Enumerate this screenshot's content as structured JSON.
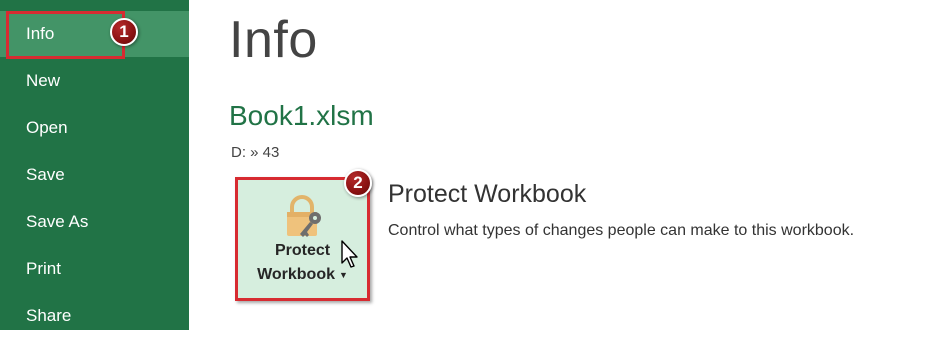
{
  "sidebar": {
    "items": [
      {
        "label": "Info"
      },
      {
        "label": "New"
      },
      {
        "label": "Open"
      },
      {
        "label": "Save"
      },
      {
        "label": "Save As"
      },
      {
        "label": "Print"
      },
      {
        "label": "Share"
      }
    ],
    "selected": "Info"
  },
  "main": {
    "title": "Info",
    "file_name": "Book1.xlsm",
    "file_path": "D: » 43",
    "protect": {
      "button_line1": "Protect",
      "button_line2": "Workbook",
      "heading": "Protect Workbook",
      "description": "Control what types of changes people can make to this workbook.",
      "icon": "lock-key-icon"
    }
  },
  "annotations": {
    "step1": "1",
    "step2": "2"
  },
  "colors": {
    "sidebar_bg": "#217346",
    "sidebar_active": "#439467",
    "accent_text": "#217346",
    "highlight_border": "#d72b31",
    "badge": "#8a1212",
    "button_bg": "#d6eede"
  }
}
